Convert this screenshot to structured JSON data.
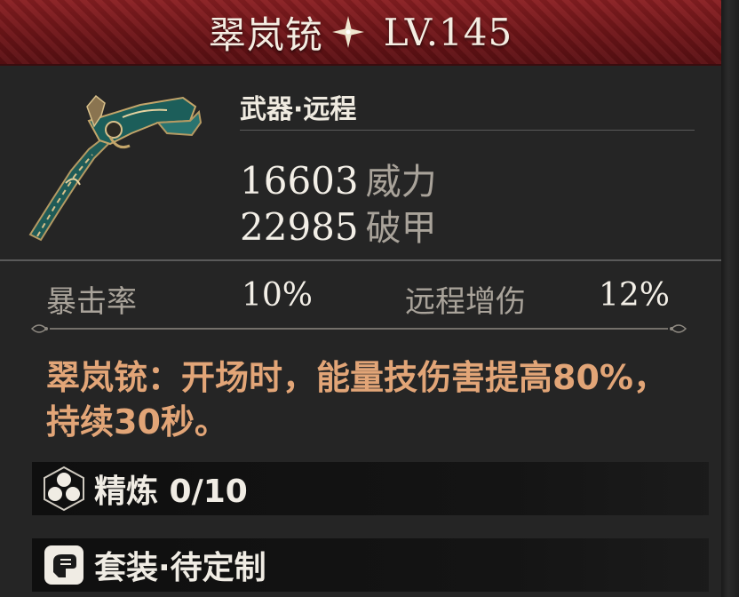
{
  "title": {
    "name": "翠岚铳",
    "level": "LV.145"
  },
  "item": {
    "category": "武器·远程",
    "stats": [
      {
        "value": "16603",
        "label": "威力"
      },
      {
        "value": "22985",
        "label": "破甲"
      }
    ]
  },
  "sub_stats": [
    {
      "label": "暴击率",
      "value": "10%"
    },
    {
      "label": "远程增伤",
      "value": "12%"
    }
  ],
  "effect_text": "翠岚铳：开场时，能量技伤害提高80%，持续30秒。",
  "refine": {
    "label": "精炼 0/10"
  },
  "set": {
    "label": "套装·待定制"
  },
  "colors": {
    "banner": "#7a1a1d",
    "panel": "#252525",
    "effect_text": "#e2a577",
    "muted_label": "#a9a39a",
    "weapon_teal": "#1f6a63",
    "weapon_gold": "#b59a63"
  },
  "icons": {
    "title_star": "four-point-star-icon",
    "weapon": "flintlock-pistol-icon",
    "refine": "hexagon-cluster-icon",
    "set": "armored-fist-icon"
  }
}
